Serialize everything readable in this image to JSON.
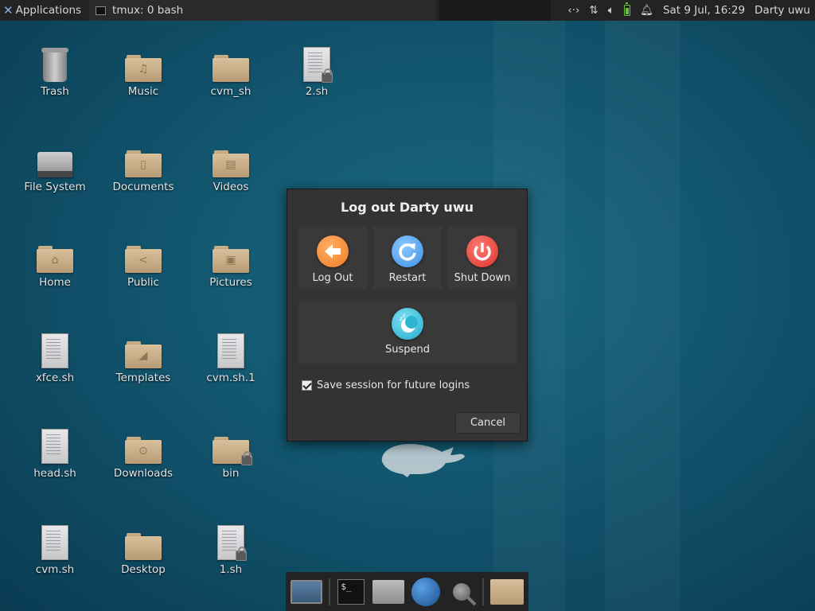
{
  "top_panel": {
    "applications_label": "Applications",
    "task_label": "tmux: 0 bash",
    "clock": "Sat  9 Jul, 16:29",
    "user": "Darty uwu"
  },
  "desktop": {
    "icons": {
      "trash": "Trash",
      "music": "Music",
      "cvm_sh": "cvm_sh",
      "two_sh": "2.sh",
      "file_system": "File System",
      "documents": "Documents",
      "videos": "Videos",
      "home": "Home",
      "public": "Public",
      "pictures": "Pictures",
      "xfce_sh": "xfce.sh",
      "templates": "Templates",
      "cvm_sh_1": "cvm.sh.1",
      "head_sh": "head.sh",
      "downloads": "Downloads",
      "bin": "bin",
      "cvm_sh_file": "cvm.sh",
      "desktop": "Desktop",
      "one_sh": "1.sh"
    }
  },
  "dialog": {
    "title": "Log out Darty uwu",
    "log_out": "Log Out",
    "restart": "Restart",
    "shut_down": "Shut Down",
    "suspend": "Suspend",
    "save_session": "Save session for future logins",
    "save_session_checked": true,
    "cancel": "Cancel"
  },
  "dock": {
    "terminal_prompt": "$_"
  },
  "colors": {
    "panel": "#232323",
    "dialog_bg": "#333333",
    "logout_orange": "#f07a22",
    "restart_blue": "#3b8ee3",
    "shutdown_red": "#d8332a",
    "suspend_cyan": "#21a9cc"
  }
}
